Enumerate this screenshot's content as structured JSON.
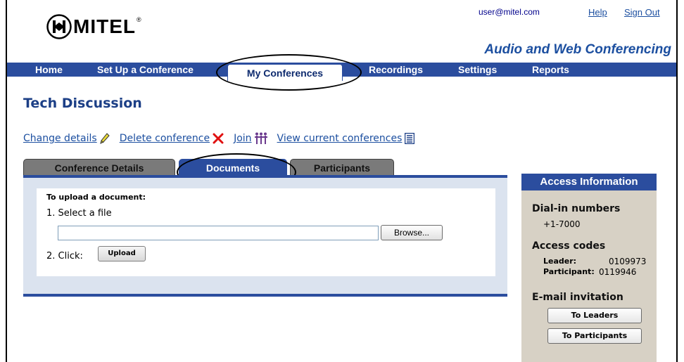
{
  "brand": {
    "name": "MITEL",
    "reg_mark": "®",
    "tagline": "Audio and Web Conferencing"
  },
  "top": {
    "user": "user@mitel.com",
    "help": "Help",
    "sign_out": "Sign Out"
  },
  "nav": {
    "home": "Home",
    "setup": "Set Up a Conference",
    "my_conferences": "My Conferences",
    "recordings": "Recordings",
    "settings": "Settings",
    "reports": "Reports",
    "active": "My Conferences"
  },
  "page": {
    "title": "Tech Discussion"
  },
  "actions": {
    "change": "Change details",
    "delete": "Delete conference",
    "join": "Join",
    "view": "View current conferences"
  },
  "tabs": {
    "details": "Conference Details",
    "documents": "Documents",
    "participants": "Participants",
    "active": "Documents"
  },
  "upload": {
    "heading": "To upload a document:",
    "step1": "1. Select a file",
    "file_value": "",
    "browse": "Browse...",
    "step2": "2. Click:",
    "upload_button": "Upload"
  },
  "access": {
    "header": "Access Information",
    "dialin_heading": "Dial-in numbers",
    "dialin_number": "+1-7000",
    "codes_heading": "Access codes",
    "leader_label": "Leader:",
    "leader_code": "0109973",
    "participant_label": "Participant:",
    "participant_code": "0119946",
    "email_heading": "E-mail invitation",
    "to_leaders": "To Leaders",
    "to_participants": "To Participants"
  },
  "colors": {
    "nav_blue": "#2b4d9e",
    "link_blue": "#1c4fa0",
    "sidebar_bg": "#d7d1c5",
    "panel_bg": "#dbe3ef",
    "delete_red": "#e01010"
  },
  "icons": [
    "pencil-icon",
    "delete-x-icon",
    "join-people-icon",
    "list-icon"
  ]
}
